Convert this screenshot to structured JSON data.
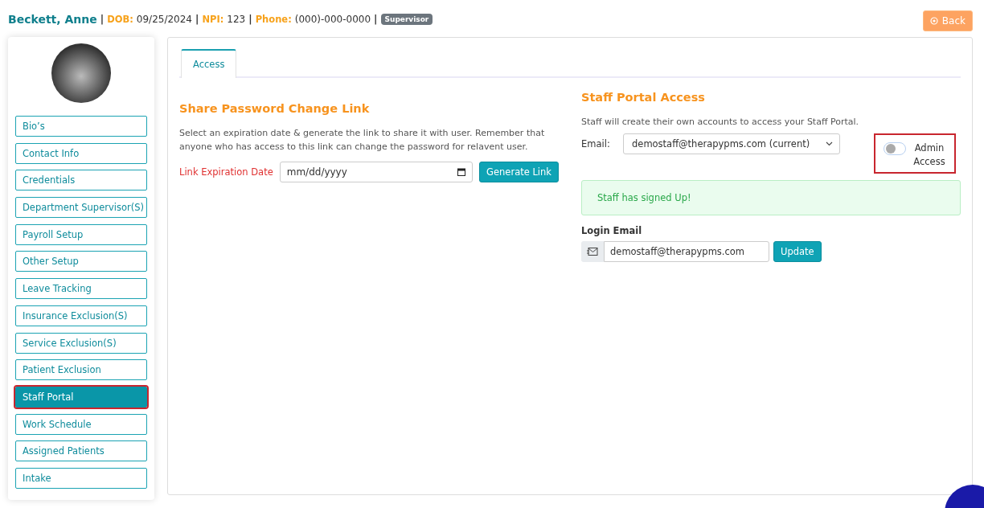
{
  "header": {
    "name": "Beckett, Anne",
    "fields": [
      {
        "label": "DOB:",
        "value": "09/25/2024"
      },
      {
        "label": "NPI:",
        "value": "123"
      },
      {
        "label": "Phone:",
        "value": "(000)-000-0000"
      }
    ],
    "separator": "|",
    "badge": "Supervisor",
    "back_button": "Back"
  },
  "sidebar": {
    "items": [
      {
        "label": "Bio’s",
        "selected": false
      },
      {
        "label": "Contact Info",
        "selected": false
      },
      {
        "label": "Credentials",
        "selected": false
      },
      {
        "label": "Department Supervisor(S)",
        "selected": false
      },
      {
        "label": "Payroll Setup",
        "selected": false
      },
      {
        "label": "Other Setup",
        "selected": false
      },
      {
        "label": "Leave Tracking",
        "selected": false
      },
      {
        "label": "Insurance Exclusion(S)",
        "selected": false
      },
      {
        "label": "Service Exclusion(S)",
        "selected": false
      },
      {
        "label": "Patient Exclusion",
        "selected": false
      },
      {
        "label": "Staff Portal",
        "selected": true
      },
      {
        "label": "Work Schedule",
        "selected": false
      },
      {
        "label": "Assigned Patients",
        "selected": false
      },
      {
        "label": "Intake",
        "selected": false
      }
    ]
  },
  "tabs": [
    {
      "label": "Access",
      "selected": true
    }
  ],
  "share_link": {
    "title": "Share Password Change Link",
    "description": "Select an expiration date & generate the link to share it with user. Remember that anyone who has access to this link can change the password for relavent user.",
    "date_label": "Link Expiration Date",
    "date_placeholder": "mm/dd/yyyy",
    "button": "Generate Link"
  },
  "portal_access": {
    "title": "Staff Portal Access",
    "description": "Staff will create their own accounts to access your Staff Portal.",
    "email_label": "Email:",
    "email_value": "demostaff@therapypms.com (current)",
    "admin_toggle": {
      "label": "Admin Access",
      "on": false,
      "highlighted": true
    },
    "alert": "Staff has signed Up!",
    "login_label": "Login Email",
    "login_value": "demostaff@therapypms.com",
    "update_button": "Update"
  }
}
